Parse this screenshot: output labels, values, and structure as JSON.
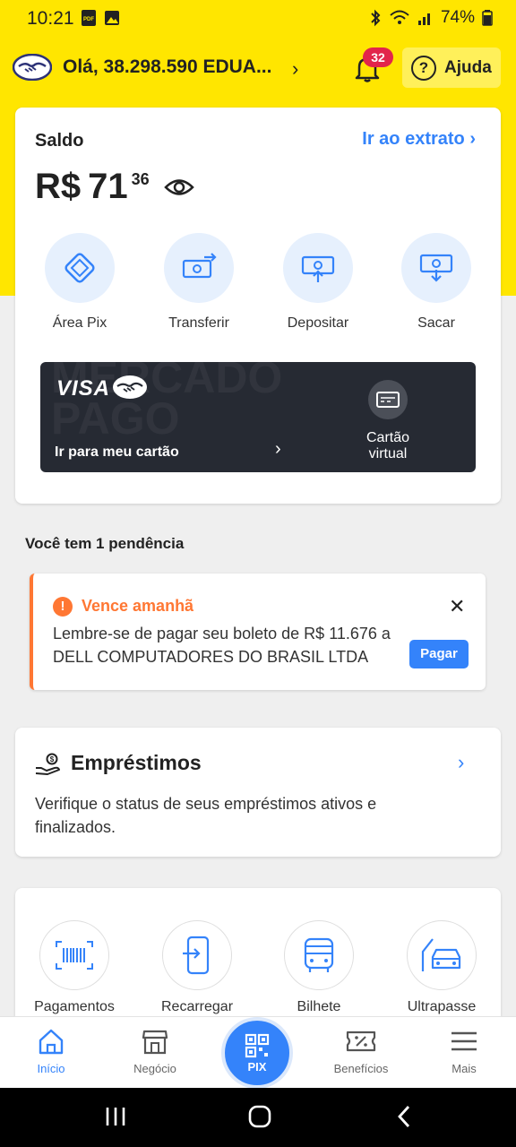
{
  "status_bar": {
    "time": "10:21",
    "battery": "74%"
  },
  "header": {
    "greeting": "Olá, 38.298.590 EDUA...",
    "notif_count": "32",
    "help_label": "Ajuda"
  },
  "balance": {
    "label": "Saldo",
    "extrato_link": "Ir ao extrato",
    "currency": "R$",
    "integer": "71",
    "cents": "36"
  },
  "actions": [
    {
      "label": "Área Pix",
      "icon": "pix-icon"
    },
    {
      "label": "Transferir",
      "icon": "transfer-icon"
    },
    {
      "label": "Depositar",
      "icon": "deposit-icon"
    },
    {
      "label": "Sacar",
      "icon": "withdraw-icon"
    }
  ],
  "card": {
    "brand": "VISA",
    "watermark": "MERCADO PAGO",
    "go_label": "Ir para meu cartão",
    "virtual_line1": "Cartão",
    "virtual_line2": "virtual"
  },
  "pending": {
    "title": "Você tem 1 pendência",
    "heading": "Vence amanhã",
    "text": "Lembre-se de pagar seu boleto de R$ 11.676 a DELL COMPUTADORES DO BRASIL LTDA",
    "pay_label": "Pagar"
  },
  "loans": {
    "title": "Empréstimos",
    "text": "Verifique o status de seus empréstimos ativos e finalizados."
  },
  "services": [
    {
      "label": "Pagamentos",
      "icon": "barcode-icon"
    },
    {
      "label": "Recarregar",
      "icon": "phone-recharge-icon"
    },
    {
      "label": "Bilhete",
      "icon": "bus-icon"
    },
    {
      "label": "Ultrapasse",
      "icon": "car-toll-icon"
    }
  ],
  "nav": {
    "home": "Início",
    "business": "Negócio",
    "pix": "PIX",
    "benefits": "Benefícios",
    "more": "Mais"
  },
  "colors": {
    "yellow": "#ffe600",
    "blue": "#3483fa",
    "orange": "#ff7733",
    "badge": "#e2254b"
  }
}
